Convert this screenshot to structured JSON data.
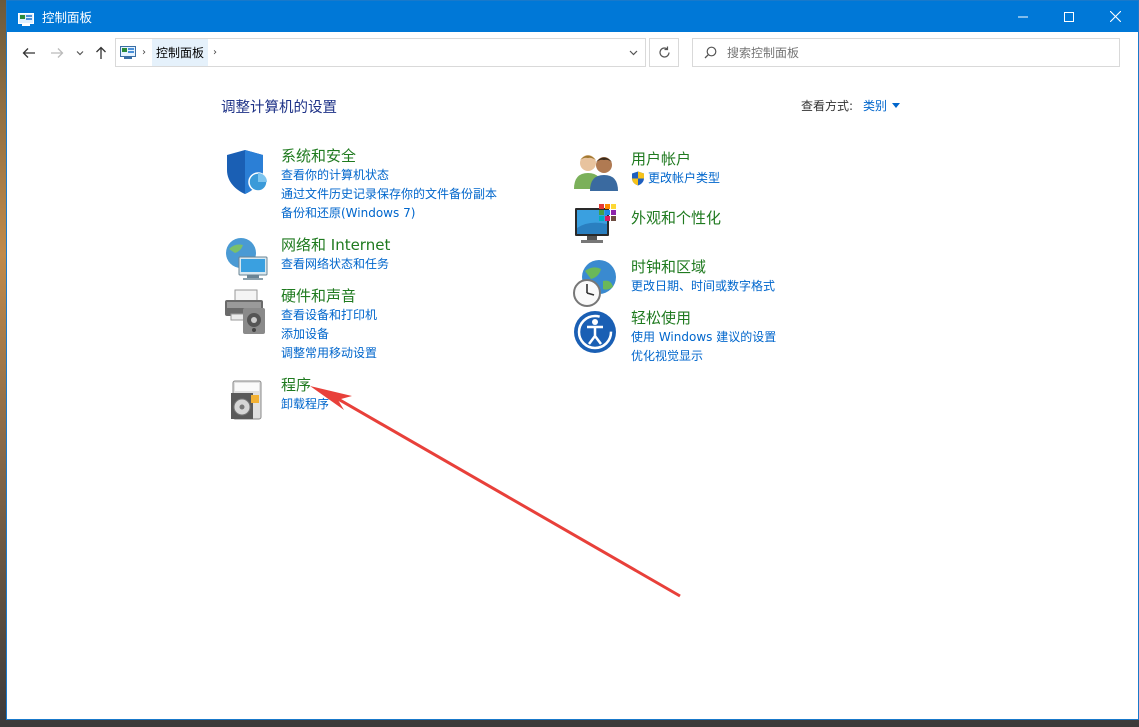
{
  "window": {
    "title": "控制面板"
  },
  "titlebar_controls": {
    "minimize": "minimize-icon",
    "maximize": "maximize-icon",
    "close": "close-icon"
  },
  "address": {
    "crumbs": [
      "控制面板"
    ]
  },
  "search": {
    "placeholder": "搜索控制面板"
  },
  "header": {
    "title": "调整计算机的设置",
    "view_by_label": "查看方式:",
    "view_by_value": "类别"
  },
  "categories_left": [
    {
      "title": "系统和安全",
      "links": [
        "查看你的计算机状态",
        "通过文件历史记录保存你的文件备份副本",
        "备份和还原(Windows 7)"
      ]
    },
    {
      "title": "网络和 Internet",
      "links": [
        "查看网络状态和任务"
      ]
    },
    {
      "title": "硬件和声音",
      "links": [
        "查看设备和打印机",
        "添加设备",
        "调整常用移动设置"
      ]
    },
    {
      "title": "程序",
      "links": [
        "卸载程序"
      ]
    }
  ],
  "categories_right": [
    {
      "title": "用户帐户",
      "links": [
        "更改帐户类型"
      ]
    },
    {
      "title": "外观和个性化",
      "links": []
    },
    {
      "title": "时钟和区域",
      "links": [
        "更改日期、时间或数字格式"
      ]
    },
    {
      "title": "轻松使用",
      "links": [
        "使用 Windows 建议的设置",
        "优化视觉显示"
      ]
    }
  ],
  "colors": {
    "accent": "#0078d7",
    "link": "#0066cc",
    "category": "#1f7a1f",
    "annotation_arrow": "#e8403a"
  }
}
